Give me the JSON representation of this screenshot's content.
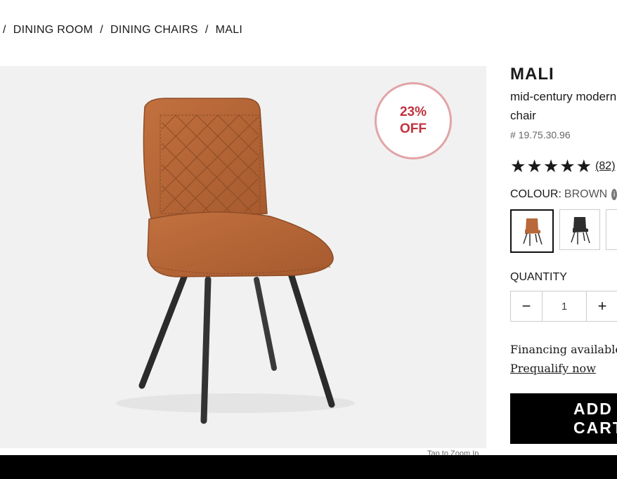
{
  "breadcrumb": {
    "sep": "/",
    "items": [
      "DINING ROOM",
      "DINING CHAIRS",
      "MALI"
    ]
  },
  "badge": {
    "percent": "23%",
    "label": "OFF"
  },
  "gallery": {
    "zoom_hint": "Tap to Zoom In"
  },
  "product": {
    "name": "MALI",
    "description": "mid-century modern chair",
    "sku": "# 19.75.30.96",
    "stars": "★★★★★",
    "rating_value": 5,
    "review_count": "(82)"
  },
  "colour": {
    "label": "COLOUR:",
    "value": "BROWN",
    "info_icon": "i",
    "swatches": [
      {
        "name": "brown",
        "color": "#b8683a",
        "selected": true
      },
      {
        "name": "black",
        "color": "#2e2e2e",
        "selected": false
      },
      {
        "name": "other",
        "color": "#ffffff",
        "selected": false
      }
    ]
  },
  "quantity": {
    "label": "QUANTITY",
    "minus": "−",
    "value": "1",
    "plus": "+"
  },
  "financing": {
    "text": "Financing available from",
    "link": "Prequalify now"
  },
  "cart": {
    "add_label": "ADD TO CART"
  },
  "colors": {
    "accent_sale": "#c0333f",
    "chair_leather": "#b8683a",
    "button_bg": "#000000"
  }
}
